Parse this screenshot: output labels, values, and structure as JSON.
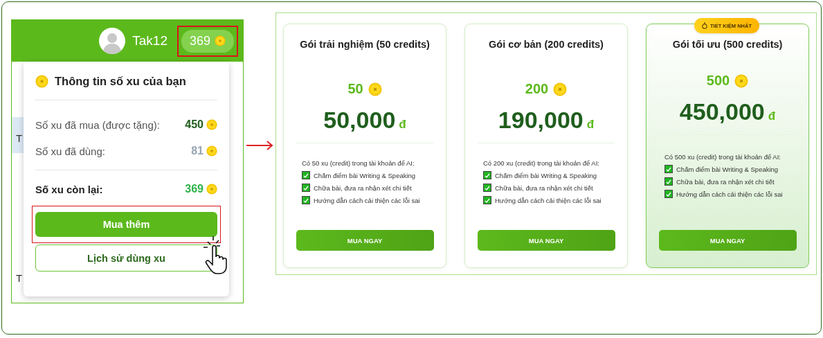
{
  "left_screen": {
    "user": {
      "name": "Tak12"
    },
    "balance_badge": {
      "amount": "369",
      "highlighted": true
    },
    "background_fragments": [
      "T",
      "T"
    ],
    "popup": {
      "title": "Thông tin số xu của bạn",
      "rows": [
        {
          "kind": "bought",
          "label": "Số xu đã mua (được tặng):",
          "value": "450"
        },
        {
          "kind": "used",
          "label": "Số xu đã dùng:",
          "value": "81"
        },
        {
          "kind": "remaining",
          "label": "Số xu còn lại:",
          "value": "369"
        }
      ],
      "buttons": [
        {
          "kind": "primary",
          "label": "Mua thêm",
          "highlighted": true
        },
        {
          "kind": "outline",
          "label": "Lịch sử dùng xu"
        }
      ]
    }
  },
  "packages": [
    {
      "title": "Gói trải nghiệm (50 credits)",
      "featured": false,
      "coins": "50",
      "price": "50,000",
      "currency": "đ",
      "intro": "Có 50 xu (credit) trong tài khoản để AI:",
      "features": [
        {
          "text": "Chấm điểm bài Writing & Speaking",
          "checked": true
        },
        {
          "text": "Chữa bài, đưa ra nhận xét chi tiết",
          "checked": true
        },
        {
          "text": "Hướng dẫn cách cải thiện các lỗi sai",
          "checked": true
        }
      ],
      "button": "MUA NGAY"
    },
    {
      "title": "Gói cơ bản (200 credits)",
      "featured": false,
      "coins": "200",
      "price": "190,000",
      "currency": "đ",
      "intro": "Có 200 xu (credit) trong tài khoản để AI:",
      "features": [
        {
          "text": "Chấm điểm bài Writing & Speaking",
          "checked": true
        },
        {
          "text": "Chữa bài, đưa ra nhận xét chi tiết",
          "checked": true
        },
        {
          "text": "Hướng dẫn cách cải thiện các lỗi sai",
          "checked": true
        }
      ],
      "button": "MUA NGAY"
    },
    {
      "title": "Gói tối ưu (500 credits)",
      "featured": true,
      "badge": "TIẾT KIỆM NHẤT",
      "coins": "500",
      "price": "450,000",
      "currency": "đ",
      "intro": "Có 500 xu (credit) trong tài khoản để AI:",
      "features": [
        {
          "text": "Chấm điểm bài Writing & Speaking",
          "checked": true
        },
        {
          "text": "Chữa bài, đưa ra nhận xét chi tiết",
          "checked": true
        },
        {
          "text": "Hướng dẫn cách cải thiện các lỗi sai",
          "checked": true
        }
      ],
      "button": "MUA NGAY"
    }
  ]
}
